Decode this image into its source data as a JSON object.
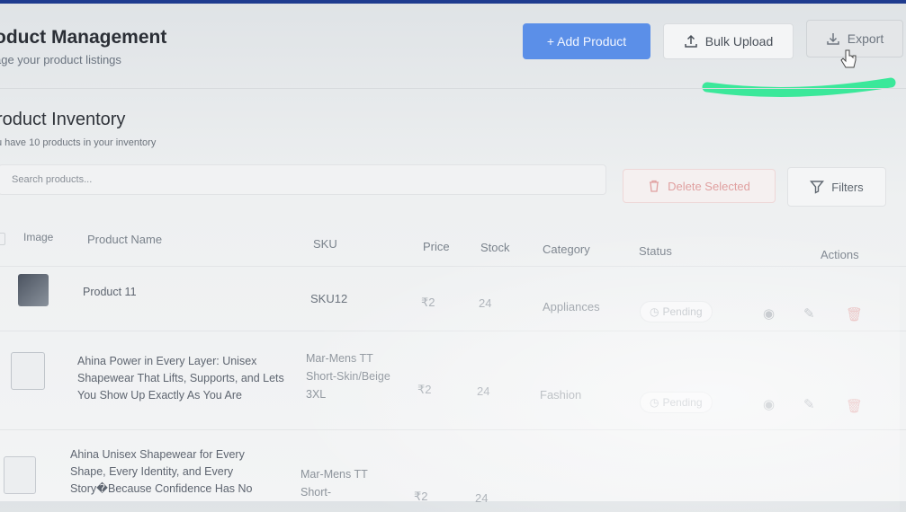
{
  "header": {
    "title": "oduct Management",
    "subtitle": "age your product listings",
    "add_label": "+ Add Product",
    "bulk_label": "Bulk Upload",
    "export_label": "Export"
  },
  "inventory": {
    "title": "roduct Inventory",
    "subtitle": "u have 10 products in your inventory",
    "search_placeholder": "Search products...",
    "delete_label": "Delete Selected",
    "filters_label": "Filters"
  },
  "table": {
    "headers": {
      "image": "Image",
      "name": "Product Name",
      "sku": "SKU",
      "price": "Price",
      "stock": "Stock",
      "category": "Category",
      "status": "Status",
      "actions": "Actions"
    },
    "rows": [
      {
        "name": "Product 11",
        "sku": "SKU12",
        "price": "₹2",
        "stock": "24",
        "category": "Appliances",
        "status": "Pending"
      },
      {
        "name": "Ahina Power in Every Layer: Unisex Shapewear That Lifts, Supports, and Lets You Show Up Exactly As You Are",
        "sku": "Mar-Mens TT Short-Skin/Beige 3XL",
        "price": "₹2",
        "stock": "24",
        "category": "Fashion",
        "status": "Pending"
      },
      {
        "name": "Ahina Unisex Shapewear for Every Shape, Every Identity, and Every Story�Because Confidence Has No",
        "sku": "Mar-Mens TT Short-",
        "price": "₹2",
        "stock": "24",
        "category": "",
        "status": ""
      }
    ]
  },
  "colors": {
    "primary": "#5b8fe8",
    "marker": "#3be89a",
    "danger_light": "#e0a0a0"
  }
}
